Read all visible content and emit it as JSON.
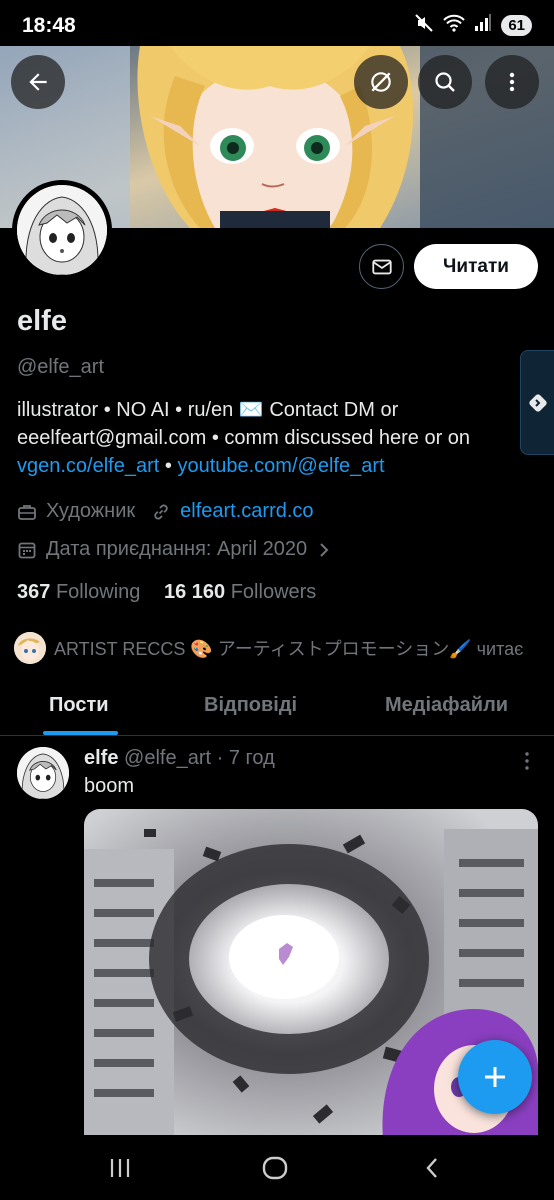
{
  "status_bar": {
    "time": "18:48",
    "battery": "61"
  },
  "profile": {
    "display_name": "elfe",
    "handle": "@elfe_art",
    "follow_label": "Читати",
    "bio_text": "illustrator • NO AI • ru/en ✉️ Contact DM or eeelfeart@gmail.com • comm discussed here or on ",
    "bio_link_1": "vgen.co/elfe_art",
    "bio_separator": " • ",
    "bio_link_2": "youtube.com/@elfe_art",
    "profession": "Художник",
    "website": "elfeart.carrd.co",
    "joined": "Дата приєднання: April 2020",
    "following_count": "367",
    "following_label": "Following",
    "followers_count": "16 160",
    "followers_label": "Followers",
    "followed_by_text": "ARTIST RECCS 🎨 アーティストプロモーション🖌️ читає"
  },
  "tabs": [
    {
      "label": "Пости",
      "active": true
    },
    {
      "label": "Відповіді",
      "active": false
    },
    {
      "label": "Медіафайли",
      "active": false
    }
  ],
  "post": {
    "author": "elfe",
    "handle": "@elfe_art",
    "separator": "·",
    "time": "7 год",
    "text": "boom"
  },
  "colors": {
    "accent": "#1d9bf0",
    "background": "#000000",
    "text_primary": "#e7e9ea",
    "text_secondary": "#71767b"
  }
}
